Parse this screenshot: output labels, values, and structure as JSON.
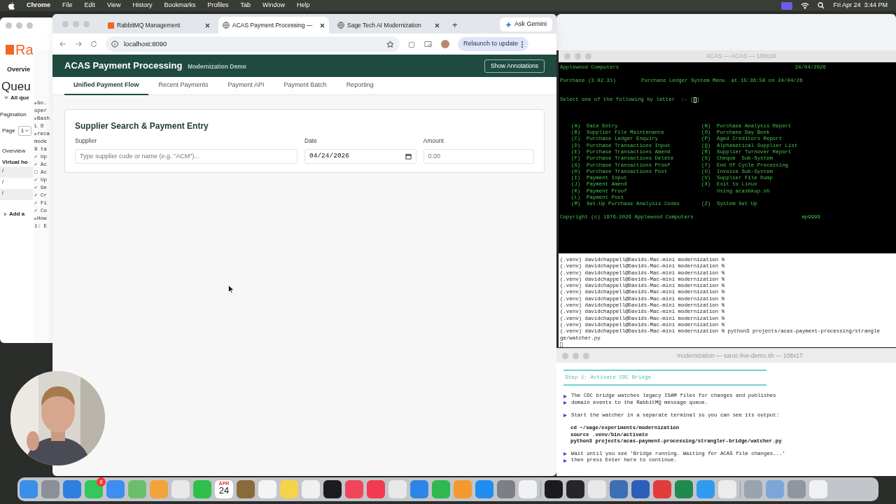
{
  "menu_bar": {
    "app": "Chrome",
    "menus": [
      "File",
      "Edit",
      "View",
      "History",
      "Bookmarks",
      "Profiles",
      "Tab",
      "Window",
      "Help"
    ],
    "clock": "Fri Apr 24  3:44 PM"
  },
  "rabbitmq_window": {
    "logo": "Ra",
    "nav": "Overvie",
    "heading": "Queu",
    "filter": "All que",
    "pagination": "Pagination",
    "page_label": "Page",
    "page_value": "1",
    "table_tab": "Overview",
    "column": "Virtual ho",
    "rows": [
      "/",
      "/",
      "/"
    ],
    "add": "Add a"
  },
  "agent_window": {
    "lines": [
      {
        "kind": "dot",
        "text": "Go."
      },
      {
        "kind": "plain",
        "text": "oper"
      },
      {
        "kind": "dot",
        "text": "Bash"
      },
      {
        "kind": "plain",
        "text": "L D"
      },
      {
        "kind": "dot",
        "text": "reca"
      },
      {
        "kind": "plain",
        "text": "mode"
      },
      {
        "kind": "plain",
        "text": "8 ta"
      },
      {
        "kind": "plain",
        "text": "✓ Up"
      },
      {
        "kind": "plain",
        "text": "✓ Ac"
      },
      {
        "kind": "plain",
        "text": "□ Ac"
      },
      {
        "kind": "plain",
        "text": "✓ Up"
      },
      {
        "kind": "plain",
        "text": "✓ Ge"
      },
      {
        "kind": "plain",
        "text": "✓ Cr"
      },
      {
        "kind": "plain",
        "text": "✓ Fi"
      },
      {
        "kind": "plain",
        "text": "✓ Co"
      },
      {
        "kind": "dot",
        "text": "How"
      },
      {
        "kind": "plain",
        "text": "1: E"
      }
    ]
  },
  "browser": {
    "tabs": [
      {
        "title": "RabbitMQ Management",
        "selected": false
      },
      {
        "title": "ACAS Payment Processing —",
        "selected": true
      },
      {
        "title": "Sage Tech AI Modernization",
        "selected": false
      }
    ],
    "new_tab": "+",
    "ask_gemini": "Ask Gemini",
    "url": "localhost:8090",
    "relaunch": "Relaunch to update"
  },
  "app": {
    "title": "ACAS Payment Processing",
    "subtitle": "Modernization Demo",
    "annotations_button": "Show Annotations",
    "tabs": [
      {
        "label": "Unified Payment Flow",
        "selected": true
      },
      {
        "label": "Recent Payments",
        "selected": false
      },
      {
        "label": "Payment API",
        "selected": false
      },
      {
        "label": "Payment Batch",
        "selected": false
      },
      {
        "label": "Reporting",
        "selected": false
      }
    ],
    "card": {
      "title": "Supplier Search & Payment Entry",
      "fields": [
        {
          "kind": "text",
          "label": "Supplier",
          "placeholder": "Type supplier code or name (e.g. \"ACM\")..."
        },
        {
          "kind": "date",
          "label": "Date",
          "value": "04/24/2026"
        },
        {
          "kind": "number",
          "label": "Amount",
          "placeholder": "0.00"
        }
      ]
    }
  },
  "acas_terminal": {
    "title": "ACAS — ACAS — 109x29",
    "company": "Applewood Computers",
    "date": "24/04/2026",
    "module": "Purchase (3.02.31)",
    "menu_title": "Purchase Ledger System Menu  at 15:36:58 on 24/04/26",
    "prompt": "Select one of the following by letter  :- [",
    "prompt_end": "]",
    "rows": [
      {
        "left_key": "(A)",
        "left_label": "Date Entry",
        "right_key": "(N)",
        "right_label": "Purchase Analysis Report"
      },
      {
        "left_key": "(B)",
        "left_label": "Supplier File Maintenance",
        "right_key": "(O)",
        "right_label": "Purchase Day Book"
      },
      {
        "left_key": "(C)",
        "left_label": "Purchase Ledger Enquiry",
        "right_key": "(P)",
        "right_label": "Aged Creditors Report"
      },
      {
        "left_key": "(D)",
        "left_label": "Purchase Transactions Input",
        "right_key": "(Q)",
        "right_label": "Alphabetical Supplier List"
      },
      {
        "left_key": "(E)",
        "left_label": "Purchase Transactions Amend",
        "right_key": "(R)",
        "right_label": "Supplier Turnover Report"
      },
      {
        "left_key": "(F)",
        "left_label": "Purchase Transactions Delete",
        "right_key": "(S)",
        "right_label": "Cheque  Sub-System"
      },
      {
        "left_key": "(G)",
        "left_label": "Purchase Transactions Proof",
        "right_key": "(T)",
        "right_label": "End Of Cycle Processing"
      },
      {
        "left_key": "(H)",
        "left_label": "Purchase Transactions Post",
        "right_key": "(U)",
        "right_label": "Invoice Sub-System"
      },
      {
        "left_key": "(I)",
        "left_label": "Payment Input",
        "right_key": "(V)",
        "right_label": "Supplier File Dump"
      },
      {
        "left_key": "(J)",
        "left_label": "Payment Amend",
        "right_key": "(X)",
        "right_label": "Exit to Linux"
      },
      {
        "left_key": "(K)",
        "left_label": "Payment Proof",
        "right_label": "Using acasbkup.sh"
      },
      {
        "left_key": "(L)",
        "left_label": "Payment Post"
      },
      {
        "left_key": "(M)",
        "left_label": "Set-Up Purchase Analysis Codes",
        "right_key": "(Z)",
        "right_label": "System Set Up"
      }
    ],
    "copyright": "Copyright (c) 1976-2026 Applewood Computers",
    "user": "mp9999"
  },
  "shell": {
    "lines": [
      "(.venv) davidchappell@Davids-Mac-mini modernization %",
      "(.venv) davidchappell@Davids-Mac-mini modernization %",
      "(.venv) davidchappell@Davids-Mac-mini modernization %",
      "(.venv) davidchappell@Davids-Mac-mini modernization %",
      "(.venv) davidchappell@Davids-Mac-mini modernization %",
      "(.venv) davidchappell@Davids-Mac-mini modernization %",
      "(.venv) davidchappell@Davids-Mac-mini modernization %",
      "(.venv) davidchappell@Davids-Mac-mini modernization %",
      "(.venv) davidchappell@Davids-Mac-mini modernization %",
      "(.venv) davidchappell@Davids-Mac-mini modernization %",
      "(.venv) davidchappell@Davids-Mac-mini modernization %",
      "(.venv) davidchappell@Davids-Mac-mini modernization % python3 projects/acas-payment-processing/strangle",
      "ge/watcher.py"
    ]
  },
  "demo_terminal": {
    "title": "modernization — saroc-live-demo.sh — 108x17",
    "step": "Step 1: Activate CDC Bridge",
    "blocks": [
      {
        "kind": "bullet",
        "text": "The CDC bridge watches legacy ISAM files for changes and publishes"
      },
      {
        "kind": "bullet",
        "text": "domain events to the RabbitMQ message queue."
      },
      {
        "kind": "gap"
      },
      {
        "kind": "bullet",
        "text": "Start the watcher in a separate terminal so you can see its output:"
      },
      {
        "kind": "gap"
      },
      {
        "kind": "command",
        "text": "cd ~/sage/experiments/modernization"
      },
      {
        "kind": "command",
        "text": "source .venv/bin/activate"
      },
      {
        "kind": "command",
        "text": "python3 projects/acas-payment-processing/strangler-bridge/watcher.py"
      },
      {
        "kind": "gap"
      },
      {
        "kind": "bullet",
        "text": "Wait until you see 'Bridge running. Waiting for ACAS file changes...'"
      },
      {
        "kind": "bullet",
        "text": "then press Enter here to continue."
      }
    ]
  },
  "dock": {
    "items": [
      {
        "kind": "app",
        "color": "#3b8fe8"
      },
      {
        "kind": "app",
        "color": "#8a8f99"
      },
      {
        "kind": "app",
        "color": "#2f7fe0"
      },
      {
        "kind": "app",
        "color": "#34c759",
        "badge": "8"
      },
      {
        "kind": "app",
        "color": "#3d8ef0"
      },
      {
        "kind": "app",
        "color": "#6cbf6a"
      },
      {
        "kind": "app",
        "color": "#f2a33a"
      },
      {
        "kind": "app",
        "color": "#e8e8e8"
      },
      {
        "kind": "app",
        "color": "#2fbf4a"
      },
      {
        "kind": "calendar",
        "month": "APR",
        "day": "24"
      },
      {
        "kind": "app",
        "color": "#8b6a3a"
      },
      {
        "kind": "app",
        "color": "#f4f4f4"
      },
      {
        "kind": "app",
        "color": "#f5d34a"
      },
      {
        "kind": "app",
        "color": "#f0f0f0"
      },
      {
        "kind": "app",
        "color": "#1c1c1e"
      },
      {
        "kind": "app",
        "color": "#f0455a"
      },
      {
        "kind": "app",
        "color": "#f23a50"
      },
      {
        "kind": "app",
        "color": "#e8e8e8"
      },
      {
        "kind": "app",
        "color": "#2d86e6"
      },
      {
        "kind": "app",
        "color": "#2fb84f"
      },
      {
        "kind": "app",
        "color": "#f29a2e"
      },
      {
        "kind": "app",
        "color": "#1f8ef0"
      },
      {
        "kind": "app",
        "color": "#7d7f85"
      },
      {
        "kind": "app",
        "color": "#f2f2f4"
      },
      {
        "kind": "separator"
      },
      {
        "kind": "app",
        "color": "#1b1b1d"
      },
      {
        "kind": "app",
        "color": "#262628"
      },
      {
        "kind": "app",
        "color": "#e8e8e8"
      },
      {
        "kind": "app",
        "color": "#3d6fb5"
      },
      {
        "kind": "app",
        "color": "#2b5fb9"
      },
      {
        "kind": "app",
        "color": "#e23b3b"
      },
      {
        "kind": "app",
        "color": "#1f8a4c"
      },
      {
        "kind": "app",
        "color": "#2e9bf0"
      },
      {
        "kind": "app",
        "color": "#ececec"
      },
      {
        "kind": "separator"
      },
      {
        "kind": "app",
        "color": "#9aa3ae"
      },
      {
        "kind": "app",
        "color": "#7aa7d8"
      },
      {
        "kind": "app",
        "color": "#8f96a0"
      },
      {
        "kind": "app",
        "color": "#f0f1f3"
      }
    ]
  }
}
